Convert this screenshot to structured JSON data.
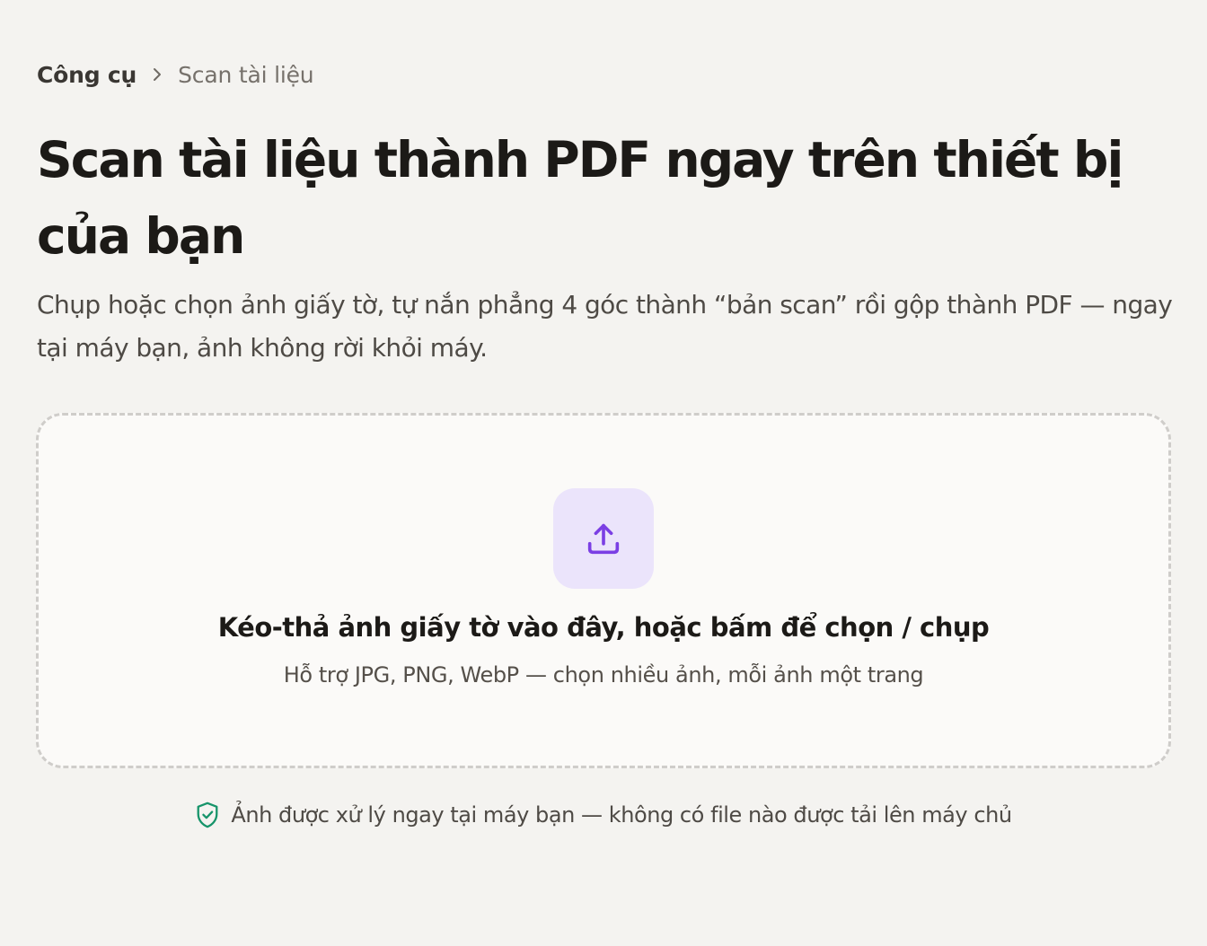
{
  "breadcrumb": {
    "root": "Công cụ",
    "separator_icon": "chevron-right-icon",
    "current": "Scan tài liệu"
  },
  "hero": {
    "title": "Scan tài liệu thành PDF ngay trên thiết bị của bạn",
    "subtitle": "Chụp hoặc chọn ảnh giấy tờ, tự nắn phẳng 4 góc thành “bản scan” rồi gộp thành PDF — ngay tại máy bạn, ảnh không rời khỏi máy."
  },
  "dropzone": {
    "icon": "upload-icon",
    "title": "Kéo-thả ảnh giấy tờ vào đây, hoặc bấm để chọn / chụp",
    "hint": "Hỗ trợ JPG, PNG, WebP — chọn nhiều ảnh, mỗi ảnh một trang"
  },
  "privacy": {
    "icon": "shield-check-icon",
    "text": "Ảnh được xử lý ngay tại máy bạn — không có file nào được tải lên máy chủ"
  },
  "colors": {
    "background": "#f4f3f0",
    "accent": "#7b3fe4",
    "accent_soft": "#ebe4fb",
    "privacy_green": "#16946a",
    "text": "#1c1a17"
  }
}
